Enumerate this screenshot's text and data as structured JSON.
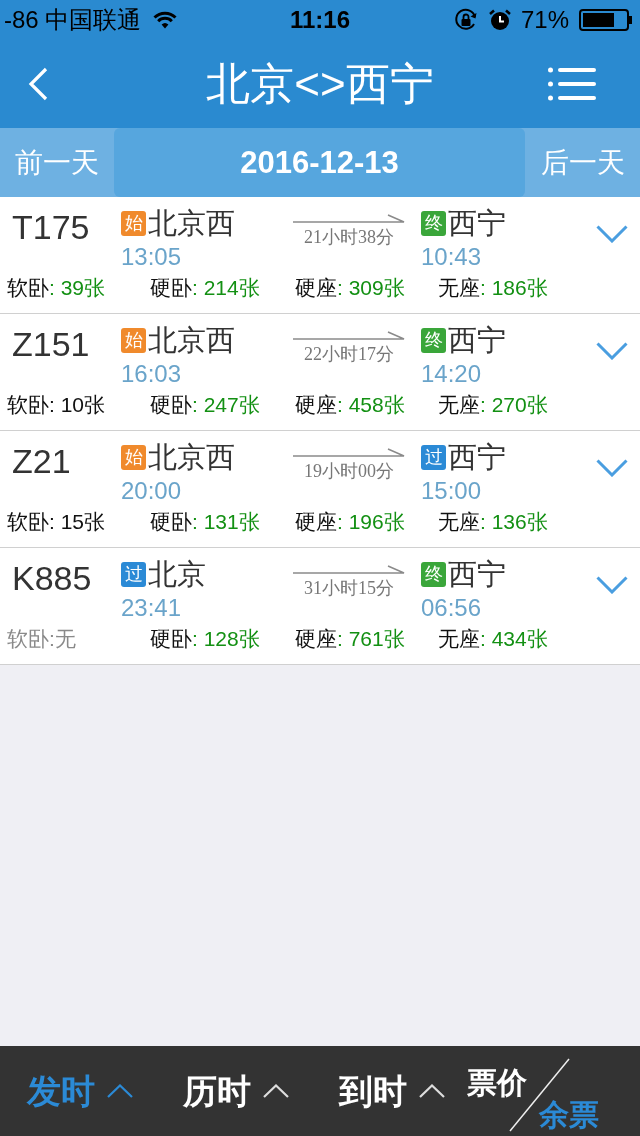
{
  "status_bar": {
    "carrier": "-86 中国联通",
    "time": "11:16",
    "battery": "71%"
  },
  "header": {
    "title": "北京<>西宁"
  },
  "date_bar": {
    "prev": "前一天",
    "date": "2016-12-13",
    "next": "后一天"
  },
  "trains": [
    {
      "number": "T175",
      "from": {
        "badge": {
          "text": "始",
          "color": "#f08a2c"
        },
        "station": "北京西",
        "time": "13:05"
      },
      "duration": "21小时38分",
      "to": {
        "badge": {
          "text": "终",
          "color": "#3aa63a"
        },
        "station": "西宁",
        "time": "10:43"
      },
      "seats": [
        {
          "label": "软卧",
          "value": ": 39张",
          "kind": "ample"
        },
        {
          "label": "硬卧",
          "value": ": 214张",
          "kind": "ample"
        },
        {
          "label": "硬座",
          "value": ": 309张",
          "kind": "ample"
        },
        {
          "label": "无座",
          "value": ": 186张",
          "kind": "ample"
        }
      ]
    },
    {
      "number": "Z151",
      "from": {
        "badge": {
          "text": "始",
          "color": "#f08a2c"
        },
        "station": "北京西",
        "time": "16:03"
      },
      "duration": "22小时17分",
      "to": {
        "badge": {
          "text": "终",
          "color": "#3aa63a"
        },
        "station": "西宁",
        "time": "14:20"
      },
      "seats": [
        {
          "label": "软卧",
          "value": ": 10张",
          "kind": "limited"
        },
        {
          "label": "硬卧",
          "value": ": 247张",
          "kind": "ample"
        },
        {
          "label": "硬座",
          "value": ": 458张",
          "kind": "ample"
        },
        {
          "label": "无座",
          "value": ": 270张",
          "kind": "ample"
        }
      ]
    },
    {
      "number": "Z21",
      "from": {
        "badge": {
          "text": "始",
          "color": "#f08a2c"
        },
        "station": "北京西",
        "time": "20:00"
      },
      "duration": "19小时00分",
      "to": {
        "badge": {
          "text": "过",
          "color": "#2b8ad6"
        },
        "station": "西宁",
        "time": "15:00"
      },
      "seats": [
        {
          "label": "软卧",
          "value": ": 15张",
          "kind": "limited"
        },
        {
          "label": "硬卧",
          "value": ": 131张",
          "kind": "ample"
        },
        {
          "label": "硬座",
          "value": ": 196张",
          "kind": "ample"
        },
        {
          "label": "无座",
          "value": ": 136张",
          "kind": "ample"
        }
      ]
    },
    {
      "number": "K885",
      "from": {
        "badge": {
          "text": "过",
          "color": "#2b8ad6"
        },
        "station": "北京",
        "time": "23:41"
      },
      "duration": "31小时15分",
      "to": {
        "badge": {
          "text": "终",
          "color": "#3aa63a"
        },
        "station": "西宁",
        "time": "06:56"
      },
      "seats": [
        {
          "label": "软卧",
          "value": ":无",
          "kind": "none"
        },
        {
          "label": "硬卧",
          "value": ": 128张",
          "kind": "ample"
        },
        {
          "label": "硬座",
          "value": ": 761张",
          "kind": "ample"
        },
        {
          "label": "无座",
          "value": ": 434张",
          "kind": "ample"
        }
      ]
    }
  ],
  "sort_bar": {
    "options": [
      {
        "label": "发时",
        "selected": true
      },
      {
        "label": "历时",
        "selected": false
      },
      {
        "label": "到时",
        "selected": false
      }
    ],
    "toggle": [
      {
        "label": "票价",
        "selected": false
      },
      {
        "label": "余票",
        "selected": true
      }
    ]
  }
}
